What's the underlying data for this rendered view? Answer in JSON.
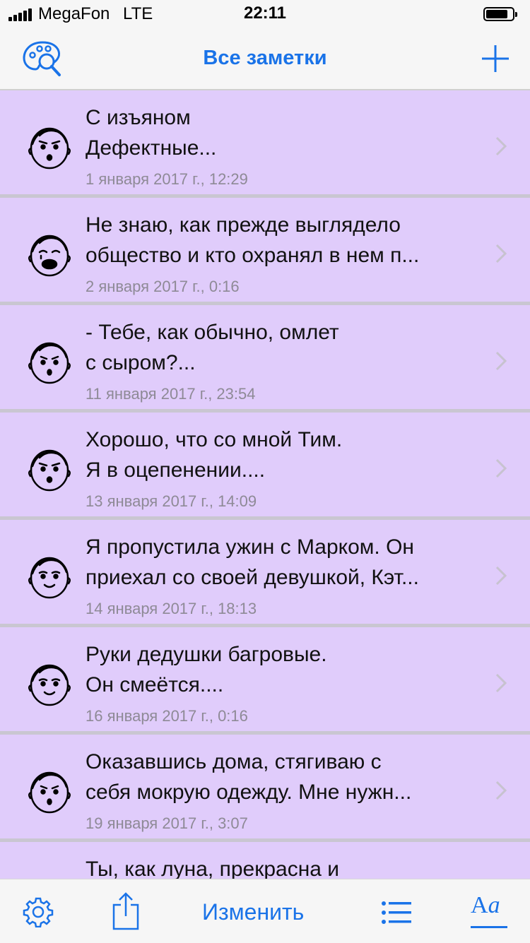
{
  "status_bar": {
    "carrier": "MegaFon",
    "network": "LTE",
    "time": "22:11"
  },
  "nav": {
    "title": "Все заметки",
    "left_icon": "palette-search-icon",
    "right_icon": "plus-icon"
  },
  "notes": [
    {
      "title": "С изъяном\nДефектные...",
      "date": "1 января 2017 г., 12:29",
      "mood": "angry"
    },
    {
      "title": "Не знаю, как прежде выглядело\nобщество и кто охранял в нем п...",
      "date": "2 января 2017 г., 0:16",
      "mood": "crying"
    },
    {
      "title": "- Тебе, как обычно, омлет\nс сыром?...",
      "date": "11 января 2017 г., 23:54",
      "mood": "surprised"
    },
    {
      "title": " Хорошо, что со мной Тим.\nЯ в оцепенении....",
      "date": "13 января 2017 г., 14:09",
      "mood": "angry"
    },
    {
      "title": "Я пропустила ужин с Марком. Он\nприехал со своей девушкой, Кэт...",
      "date": "14 января 2017 г., 18:13",
      "mood": "smile"
    },
    {
      "title": "Руки дедушки багровые.\nОн смеётся....",
      "date": "16 января 2017 г., 0:16",
      "mood": "smile"
    },
    {
      "title": "Оказавшись дома, стягиваю с\nсебя мокрую одежду. Мне нужн...",
      "date": "19 января 2017 г., 3:07",
      "mood": "surprised"
    },
    {
      "title": "Ты, как луна, прекрасна и",
      "date": "",
      "mood": "neutral"
    }
  ],
  "toolbar": {
    "edit_label": "Изменить",
    "font_label_a": "A",
    "font_label_b": "a",
    "icons": [
      "gear-icon",
      "share-icon",
      "list-icon",
      "font-icon"
    ]
  },
  "colors": {
    "accent": "#1a73e8",
    "row_background": "#e0ccfb",
    "separator": "#c9c6d1",
    "date_text": "#8e8a96"
  }
}
